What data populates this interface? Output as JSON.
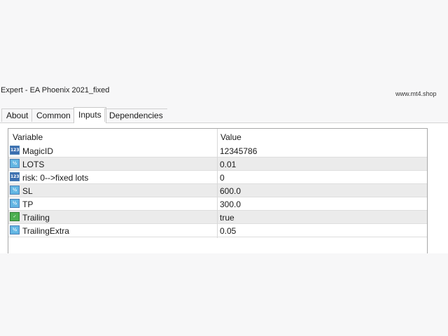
{
  "window": {
    "title": "Expert - EA Phoenix 2021_fixed",
    "watermark": "www.mt4.shop"
  },
  "tabs": [
    {
      "label": "About",
      "active": false
    },
    {
      "label": "Common",
      "active": false
    },
    {
      "label": "Inputs",
      "active": true
    },
    {
      "label": "Dependencies",
      "active": false
    }
  ],
  "grid": {
    "columns": [
      "Variable",
      "Value"
    ],
    "rows": [
      {
        "icon": "int-icon",
        "name": "MagicID",
        "value": "12345786"
      },
      {
        "icon": "double-icon",
        "name": "LOTS",
        "value": "0.01"
      },
      {
        "icon": "int-icon",
        "name": "risk: 0-->fixed lots",
        "value": "0"
      },
      {
        "icon": "double-icon",
        "name": "SL",
        "value": "600.0"
      },
      {
        "icon": "double-icon",
        "name": "TP",
        "value": "300.0"
      },
      {
        "icon": "bool-icon",
        "name": "Trailing",
        "value": "true"
      },
      {
        "icon": "double-icon",
        "name": "TrailingExtra",
        "value": "0.05"
      }
    ]
  }
}
